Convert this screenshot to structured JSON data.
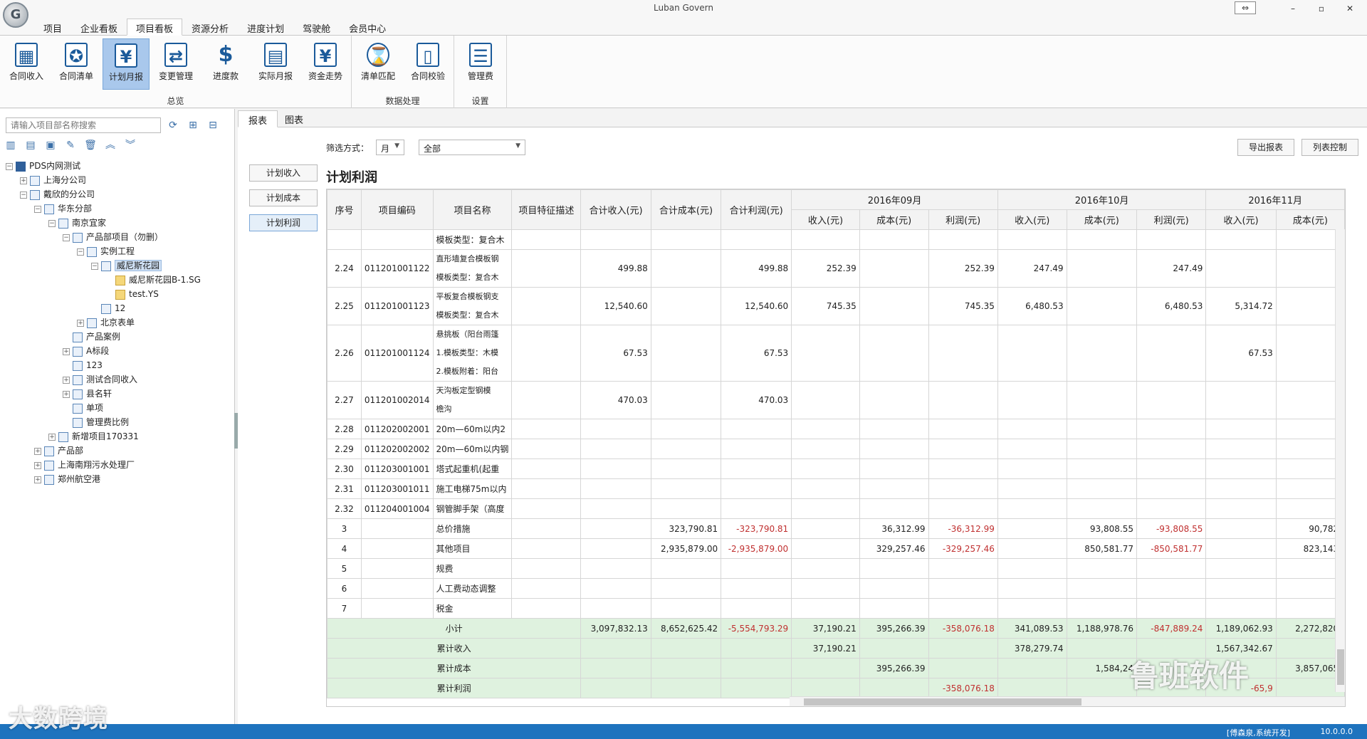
{
  "window": {
    "title": "Luban Govern",
    "controls": [
      "⇔",
      "–",
      "▫",
      "✕"
    ]
  },
  "menu_tabs": [
    "项目",
    "企业看板",
    "项目看板",
    "资源分析",
    "进度计划",
    "驾驶舱",
    "会员中心"
  ],
  "ribbon": {
    "groups": [
      {
        "label": "总览",
        "buttons": [
          {
            "label": "合同收入",
            "icon": "chart-icon"
          },
          {
            "label": "合同清单",
            "icon": "document-star-icon"
          },
          {
            "label": "计划月报",
            "icon": "yen-icon"
          },
          {
            "label": "变更管理",
            "icon": "change-icon"
          },
          {
            "label": "进度款",
            "icon": "dollar-icon"
          },
          {
            "label": "实际月报",
            "icon": "calendar-icon"
          },
          {
            "label": "资金走势",
            "icon": "yen-trend-icon"
          }
        ]
      },
      {
        "label": "数据处理",
        "buttons": [
          {
            "label": "清单匹配",
            "icon": "hourglass-icon"
          },
          {
            "label": "合同校验",
            "icon": "page-check-icon"
          }
        ]
      },
      {
        "label": "设置",
        "buttons": [
          {
            "label": "管理费",
            "icon": "coins-icon"
          }
        ]
      }
    ]
  },
  "left": {
    "search_placeholder": "请输入项目部名称搜索",
    "tree": [
      {
        "label": "PDS内网测试",
        "depth": 0,
        "exp": "−",
        "icon": "bars"
      },
      {
        "label": "上海分公司",
        "depth": 1,
        "exp": "+",
        "icon": "building"
      },
      {
        "label": "戴欣的分公司",
        "depth": 1,
        "exp": "−",
        "icon": "building"
      },
      {
        "label": "华东分部",
        "depth": 2,
        "exp": "−",
        "icon": "building"
      },
      {
        "label": "南京宜家",
        "depth": 3,
        "exp": "−",
        "icon": "list"
      },
      {
        "label": "产品部项目（勿删）",
        "depth": 4,
        "exp": "−",
        "icon": "doc"
      },
      {
        "label": "实例工程",
        "depth": 5,
        "exp": "−",
        "icon": "doc"
      },
      {
        "label": "威尼斯花园",
        "depth": 6,
        "exp": "−",
        "icon": "doc",
        "selected": true
      },
      {
        "label": "威尼斯花园B-1.SG",
        "depth": 7,
        "exp": "",
        "icon": "folder"
      },
      {
        "label": "test.YS",
        "depth": 7,
        "exp": "",
        "icon": "folder"
      },
      {
        "label": "12",
        "depth": 6,
        "exp": "",
        "icon": "doc"
      },
      {
        "label": "北京表单",
        "depth": 5,
        "exp": "+",
        "icon": "doc"
      },
      {
        "label": "产品案例",
        "depth": 4,
        "exp": "",
        "icon": "doc"
      },
      {
        "label": "A标段",
        "depth": 4,
        "exp": "+",
        "icon": "doc"
      },
      {
        "label": "123",
        "depth": 4,
        "exp": "",
        "icon": "doc"
      },
      {
        "label": "测试合同收入",
        "depth": 4,
        "exp": "+",
        "icon": "doc"
      },
      {
        "label": "县名轩",
        "depth": 4,
        "exp": "+",
        "icon": "doc"
      },
      {
        "label": "单项",
        "depth": 4,
        "exp": "",
        "icon": "doc"
      },
      {
        "label": "管理费比例",
        "depth": 4,
        "exp": "",
        "icon": "doc"
      },
      {
        "label": "新增项目170331",
        "depth": 3,
        "exp": "+",
        "icon": "list"
      },
      {
        "label": "产品部",
        "depth": 2,
        "exp": "+",
        "icon": "list"
      },
      {
        "label": "上海南翔污水处理厂",
        "depth": 2,
        "exp": "+",
        "icon": "list"
      },
      {
        "label": "郑州航空港",
        "depth": 2,
        "exp": "+",
        "icon": "list"
      }
    ]
  },
  "content": {
    "tabs": [
      "报表",
      "图表"
    ],
    "filter_label": "筛选方式：",
    "filter_period": "月",
    "filter_scope": "全部",
    "export_button": "导出报表",
    "columns_button": "列表控制",
    "side_buttons": [
      "计划收入",
      "计划成本",
      "计划利润"
    ],
    "report_title": "计划利润",
    "table": {
      "headers": [
        "序号",
        "项目编码",
        "项目名称",
        "项目特征描述",
        "合计收入(元)",
        "合计成本(元)",
        "合计利润(元)"
      ],
      "months": [
        "2016年09月",
        "2016年10月",
        "2016年11月"
      ],
      "sub_headers": [
        "收入(元)",
        "成本(元)",
        "利润(元)",
        "收入(元)",
        "成本(元)",
        "利润(元)",
        "收入(元)",
        "成本(元)"
      ],
      "rows": [
        {
          "h": 1,
          "cells": [
            "",
            "",
            "模板类型：复合木",
            "",
            "",
            "",
            "",
            "",
            "",
            "",
            "",
            "",
            "",
            "",
            ""
          ]
        },
        {
          "h": 2,
          "cells": [
            "2.24",
            "011201001122",
            "直形墙复合模板钢\n模板类型：复合木",
            "",
            "499.88",
            "",
            "499.88",
            "252.39",
            "",
            "252.39",
            "247.49",
            "",
            "247.49",
            "",
            ""
          ]
        },
        {
          "h": 2,
          "cells": [
            "2.25",
            "011201001123",
            "平板复合模板钢支\n模板类型：复合木",
            "",
            "12,540.60",
            "",
            "12,540.60",
            "745.35",
            "",
            "745.35",
            "6,480.53",
            "",
            "6,480.53",
            "5,314.72",
            ""
          ]
        },
        {
          "h": 3,
          "cells": [
            "2.26",
            "011201001124",
            "悬挑板（阳台雨篷\n1.模板类型：木模\n2.模板附着：阳台",
            "",
            "67.53",
            "",
            "67.53",
            "",
            "",
            "",
            "",
            "",
            "",
            "67.53",
            ""
          ]
        },
        {
          "h": 2,
          "cells": [
            "2.27",
            "011201002014",
            "天沟板定型钢模\n檐沟",
            "",
            "470.03",
            "",
            "470.03",
            "",
            "",
            "",
            "",
            "",
            "",
            "",
            ""
          ]
        },
        {
          "h": 1,
          "cells": [
            "2.28",
            "011202002001",
            "20m—60m以内2",
            "",
            "",
            "",
            "",
            "",
            "",
            "",
            "",
            "",
            "",
            "",
            ""
          ]
        },
        {
          "h": 1,
          "cells": [
            "2.29",
            "011202002002",
            "20m—60m以内钢",
            "",
            "",
            "",
            "",
            "",
            "",
            "",
            "",
            "",
            "",
            "",
            ""
          ]
        },
        {
          "h": 1,
          "cells": [
            "2.30",
            "011203001001",
            "塔式起重机(起重",
            "",
            "",
            "",
            "",
            "",
            "",
            "",
            "",
            "",
            "",
            "",
            ""
          ]
        },
        {
          "h": 1,
          "cells": [
            "2.31",
            "011203001011",
            "施工电梯75m以内",
            "",
            "",
            "",
            "",
            "",
            "",
            "",
            "",
            "",
            "",
            "",
            ""
          ]
        },
        {
          "h": 1,
          "cells": [
            "2.32",
            "011204001004",
            "钢管脚手架（高度",
            "",
            "",
            "",
            "",
            "",
            "",
            "",
            "",
            "",
            "",
            "",
            ""
          ]
        },
        {
          "h": 1,
          "cells": [
            "3",
            "",
            "总价措施",
            "",
            "",
            "323,790.81",
            "-323,790.81",
            "",
            "36,312.99",
            "-36,312.99",
            "",
            "93,808.55",
            "-93,808.55",
            "",
            "90,782."
          ]
        },
        {
          "h": 1,
          "cells": [
            "4",
            "",
            "其他项目",
            "",
            "",
            "2,935,879.00",
            "-2,935,879.00",
            "",
            "329,257.46",
            "-329,257.46",
            "",
            "850,581.77",
            "-850,581.77",
            "",
            "823,143."
          ]
        },
        {
          "h": 1,
          "cells": [
            "5",
            "",
            "规费",
            "",
            "",
            "",
            "",
            "",
            "",
            "",
            "",
            "",
            "",
            "",
            ""
          ]
        },
        {
          "h": 1,
          "cells": [
            "6",
            "",
            "人工费动态调整",
            "",
            "",
            "",
            "",
            "",
            "",
            "",
            "",
            "",
            "",
            "",
            ""
          ]
        },
        {
          "h": 1,
          "cells": [
            "7",
            "",
            "税金",
            "",
            "",
            "",
            "",
            "",
            "",
            "",
            "",
            "",
            "",
            "",
            ""
          ]
        }
      ],
      "summary_rows": [
        {
          "label": "小计",
          "cells": [
            "3,097,832.13",
            "8,652,625.42",
            "-5,554,793.29",
            "37,190.21",
            "395,266.39",
            "-358,076.18",
            "341,089.53",
            "1,188,978.76",
            "-847,889.24",
            "1,189,062.93",
            "2,272,820."
          ]
        },
        {
          "label": "累计收入",
          "cells": [
            "",
            "",
            "",
            "37,190.21",
            "",
            "",
            "378,279.74",
            "",
            "",
            "1,567,342.67",
            ""
          ]
        },
        {
          "label": "累计成本",
          "cells": [
            "",
            "",
            "",
            "",
            "395,266.39",
            "",
            "",
            "1,584,24",
            "",
            "",
            "3,857,065."
          ]
        },
        {
          "label": "累计利润",
          "cells": [
            "",
            "",
            "",
            "",
            "",
            "-358,076.18",
            "",
            "",
            "",
            "-65,9",
            ""
          ]
        }
      ]
    }
  },
  "status": {
    "user": "[傅森泉,系统开发]",
    "version": "10.0.0.0"
  },
  "watermarks": {
    "left": "大数跨境",
    "right": "鲁班软件"
  }
}
